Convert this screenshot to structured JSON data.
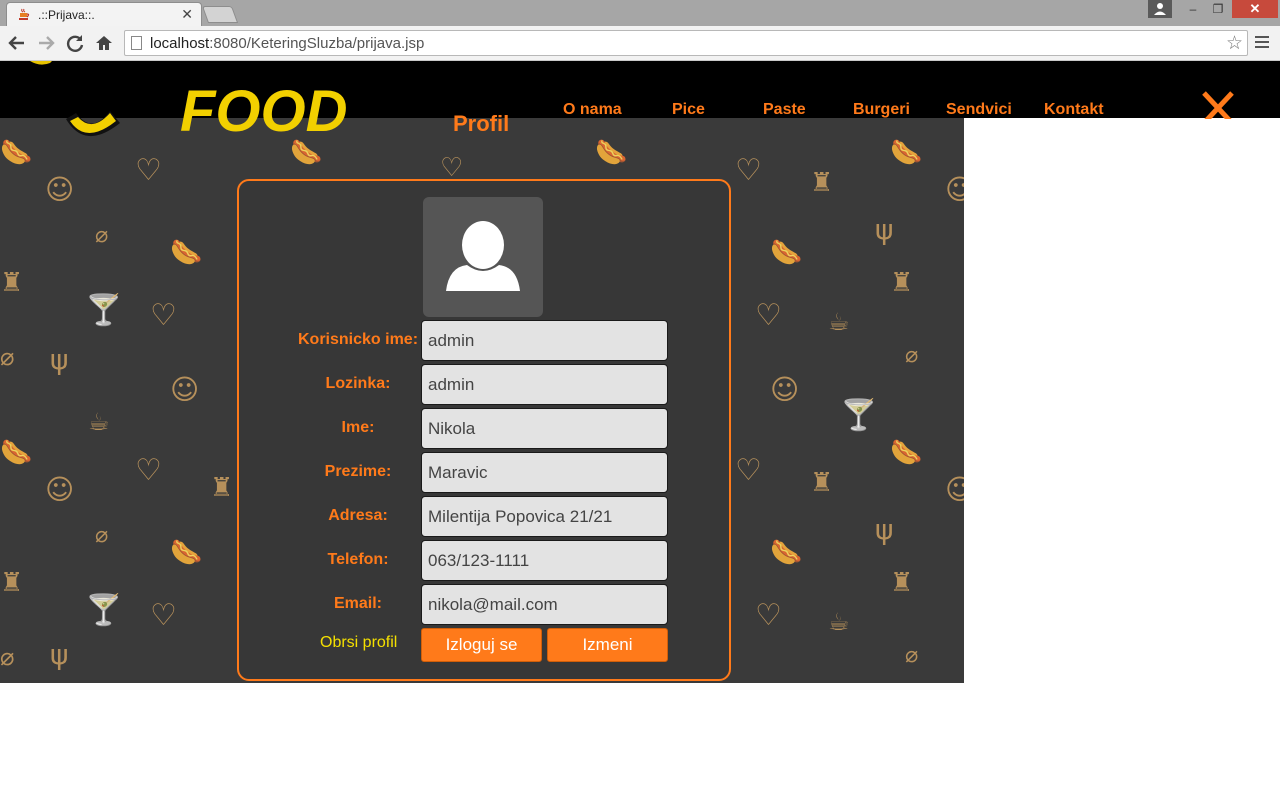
{
  "browser": {
    "tab_title": ".::Prijava::.",
    "url_host": "localhost",
    "url_rest": ":8080/KeteringSluzba/prijava.jsp",
    "window_buttons": {
      "minimize": "–",
      "restore": "❐",
      "close": "✕"
    }
  },
  "site": {
    "logo_text": "FOOD",
    "nav": [
      "O nama",
      "Pice",
      "Paste",
      "Burgeri",
      "Sendvici",
      "Kontakt"
    ],
    "close_glyph": "X",
    "accent_color": "#ff7a1a"
  },
  "profile": {
    "title": "Profil",
    "fields": [
      {
        "label": "Korisnicko ime:",
        "value": "admin"
      },
      {
        "label": "Lozinka:",
        "value": "admin"
      },
      {
        "label": "Ime:",
        "value": "Nikola"
      },
      {
        "label": "Prezime:",
        "value": "Maravic"
      },
      {
        "label": "Adresa:",
        "value": "Milentija Popovica 21/21"
      },
      {
        "label": "Telefon:",
        "value": "063/123-1111"
      },
      {
        "label": "Email:",
        "value": "nikola@mail.com"
      }
    ],
    "delete_label": "Obrsi profil",
    "logout_label": "Izloguj se",
    "edit_label": "Izmeni"
  }
}
